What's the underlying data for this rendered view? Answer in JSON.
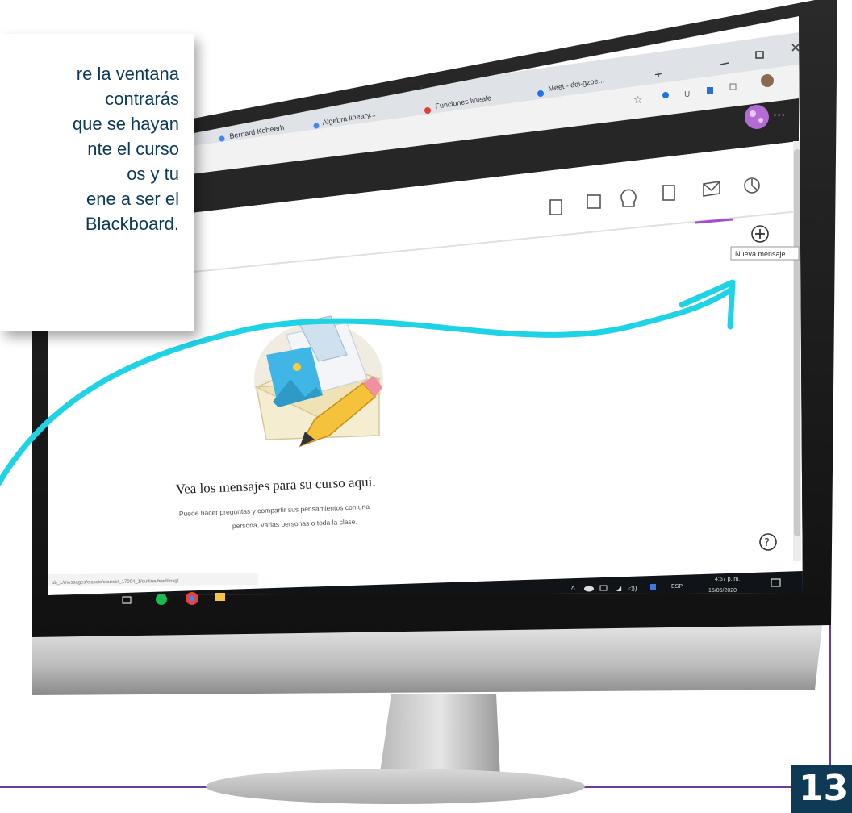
{
  "callout": {
    "lines": [
      "re la ventana",
      "contrarás",
      "que se hayan",
      "nte el curso",
      "os y tu",
      "ene a ser el",
      "Blackboard."
    ]
  },
  "page_number": "13",
  "browser": {
    "tabs": [
      {
        "label": "Bernard Koheerh"
      },
      {
        "label": "Algebra lineary..."
      },
      {
        "label": "Funciones lineale"
      },
      {
        "label": "Meet - dqi-gzoe..."
      }
    ],
    "new_tab": "+"
  },
  "course": {
    "tooltip": "Nueva mensaje",
    "empty_title": "Vea los mensajes para su curso aquí.",
    "empty_line1": "Puede hacer preguntas y compartir sus pensamientos con una",
    "empty_line2": "persona, varias personas o toda la clase.",
    "status_url": "bb_1/messages/classic/course/_17004_1/outline/feed/msg/"
  },
  "taskbar": {
    "language": "ESP",
    "time": "4:57 p. m.",
    "date": "15/05/2020"
  },
  "colors": {
    "accent_arrow": "#1fd3e6",
    "frame_line": "#6a3e94",
    "page_box": "#0f3a55",
    "active_tab_underline": "#a24dd8"
  }
}
